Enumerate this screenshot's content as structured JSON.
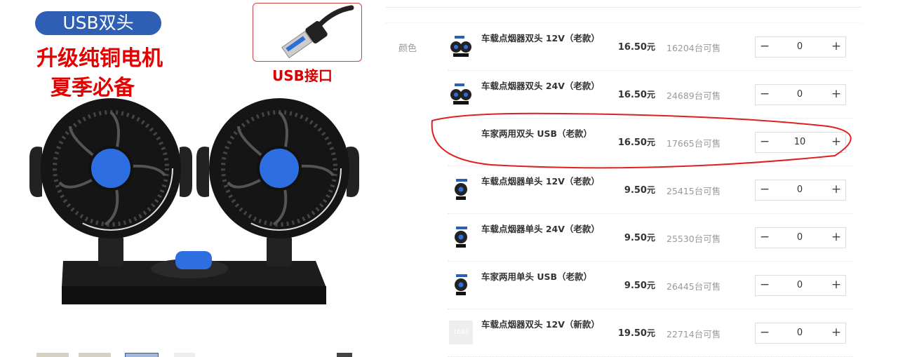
{
  "gallery": {
    "badge": "USB双头",
    "promo_line1": "升级纯铜电机",
    "promo_line2": "夏季必备",
    "usb_caption": "USB接口"
  },
  "sku": {
    "attribute_label": "颜色",
    "rows": [
      {
        "name": "车载点烟器双头 12V（老款）",
        "price": "16.50",
        "unit": "元",
        "stock": "16204台可售",
        "qty": "0",
        "icon": "dual-fan-thumb-icon"
      },
      {
        "name": "车载点烟器双头 24V（老款）",
        "price": "16.50",
        "unit": "元",
        "stock": "24689台可售",
        "qty": "0",
        "icon": "dual-fan-thumb-icon"
      },
      {
        "name": "车家两用双头 USB（老款）",
        "price": "16.50",
        "unit": "元",
        "stock": "17665台可售",
        "qty": "10",
        "icon": ""
      },
      {
        "name": "车载点烟器单头 12V（老款）",
        "price": "9.50",
        "unit": "元",
        "stock": "25415台可售",
        "qty": "0",
        "icon": "single-fan-thumb-icon"
      },
      {
        "name": "车载点烟器单头 24V（老款）",
        "price": "9.50",
        "unit": "元",
        "stock": "25530台可售",
        "qty": "0",
        "icon": "single-fan-thumb-icon"
      },
      {
        "name": "车家两用单头 USB（老款）",
        "price": "9.50",
        "unit": "元",
        "stock": "26445台可售",
        "qty": "0",
        "icon": "single-fan-thumb-icon"
      },
      {
        "name": "车载点烟器双头 12V（新款）",
        "price": "19.50",
        "unit": "元",
        "stock": "22714台可售",
        "qty": "0",
        "icon": "placeholder-thumb-icon",
        "placeholder_text": "1688"
      }
    ]
  },
  "colors": {
    "accent_blue": "#2e5fb5",
    "promo_red": "#e60000",
    "annotation_red": "#e02020"
  }
}
